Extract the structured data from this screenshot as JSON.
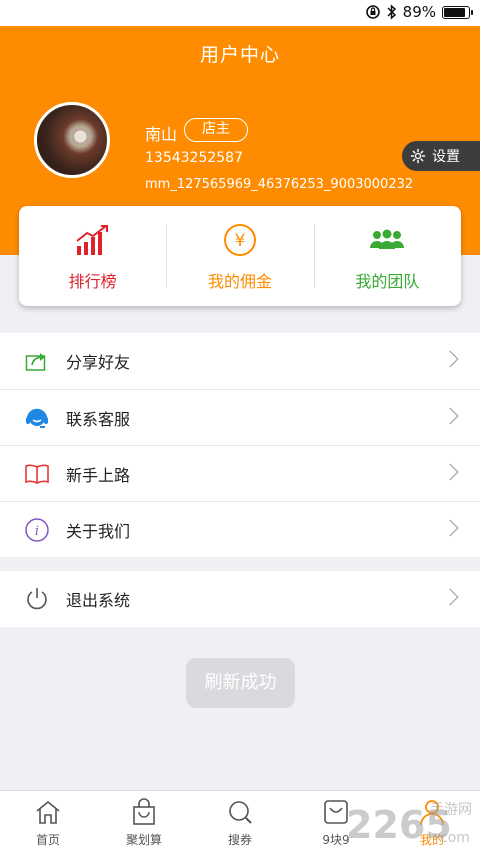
{
  "status_bar": {
    "battery": "89%",
    "battery_level": 0.89
  },
  "header": {
    "title": "用户中心",
    "bg_color": "#ff8c00"
  },
  "user": {
    "name": "南山",
    "role": "店主",
    "phone": "13543252587",
    "pid": "mm_127565969_46376253_9003000232"
  },
  "settings": {
    "label": "设置"
  },
  "quick_actions": [
    {
      "label": "排行榜",
      "color": "#e0212a",
      "icon": "ranking-chart-icon"
    },
    {
      "label": "我的佣金",
      "color": "#ff8c00",
      "icon": "yuan-coin-icon"
    },
    {
      "label": "我的团队",
      "color": "#3aaa35",
      "icon": "team-icon"
    }
  ],
  "menu": [
    {
      "label": "分享好友",
      "icon": "share-icon"
    },
    {
      "label": "联系客服",
      "icon": "customer-service-icon"
    },
    {
      "label": "新手上路",
      "icon": "book-icon"
    },
    {
      "label": "关于我们",
      "icon": "info-icon"
    }
  ],
  "logout": {
    "label": "退出系统",
    "icon": "power-icon"
  },
  "toast": {
    "text": "刷新成功"
  },
  "tabs": [
    {
      "label": "首页",
      "icon": "home-icon"
    },
    {
      "label": "聚划算",
      "icon": "shopping-bag-icon"
    },
    {
      "label": "搜券",
      "icon": "search-icon"
    },
    {
      "label": "9块9",
      "icon": "nine-icon"
    },
    {
      "label": "我的",
      "icon": "user-icon",
      "active": true
    }
  ],
  "watermark": {
    "text": "2265",
    "subtext": "手游网",
    "suffix": "com"
  }
}
